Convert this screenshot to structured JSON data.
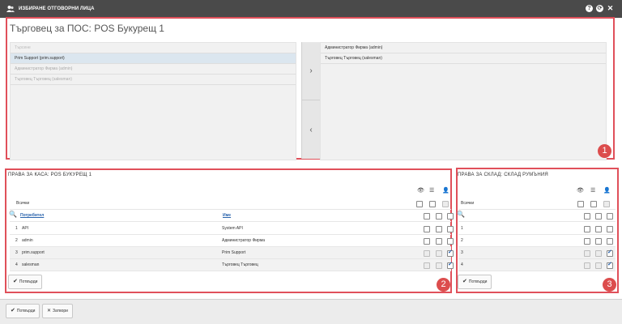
{
  "window": {
    "title": "ИЗБИРАНЕ ОТГОВОРНИ ЛИЦА",
    "buttons": {
      "help": "?",
      "refresh": "⟳",
      "close": "✕"
    }
  },
  "pos": {
    "title": "Търговец за ПОС: POS Букурещ 1",
    "left_list": {
      "search_placeholder": "Търсене",
      "items": [
        {
          "label": "Prim Support (prim.support)",
          "selected": true
        },
        {
          "label": "Администратор Фирма (admin)",
          "selected": false
        },
        {
          "label": "Търговец Търговец (salesman)",
          "selected": false
        }
      ]
    },
    "move_right": "›",
    "move_left": "‹",
    "right_list": {
      "items": [
        {
          "label": "Администратор Фирма (admin)"
        },
        {
          "label": "Търговец Търговец (salesman)"
        }
      ]
    }
  },
  "cash": {
    "title": "ПРАВА ЗА КАСА: POS БУКУРЕЩ 1",
    "all_label": "Всички",
    "col_user": "Потребител",
    "col_name": "Име",
    "rows": [
      {
        "num": "1",
        "user": "API",
        "name": "System API"
      },
      {
        "num": "2",
        "user": "admin",
        "name": "Администратор Фирма"
      },
      {
        "num": "3",
        "user": "prim.support",
        "name": "Prim Support"
      },
      {
        "num": "4",
        "user": "salesman",
        "name": "Търговец Търговец"
      }
    ],
    "confirm": "Потвърди"
  },
  "warehouse": {
    "title": "ПРАВА ЗА СКЛАД: СКЛАД РУМЪНИЯ",
    "all_label": "Всички",
    "rows": [
      {
        "num": "1"
      },
      {
        "num": "2"
      },
      {
        "num": "3"
      },
      {
        "num": "4"
      }
    ],
    "confirm": "Потвърди"
  },
  "badges": {
    "b1": "1",
    "b2": "2",
    "b3": "3"
  },
  "footer": {
    "confirm": "Потвърди",
    "close": "Затвори"
  },
  "icons": {
    "view": "eye-icon",
    "filter": "list-icon",
    "user": "user-icon",
    "search": "search-icon"
  },
  "colors": {
    "accent": "#e0505a",
    "link": "#2a64ad",
    "titlebar": "#4a4a4a"
  }
}
